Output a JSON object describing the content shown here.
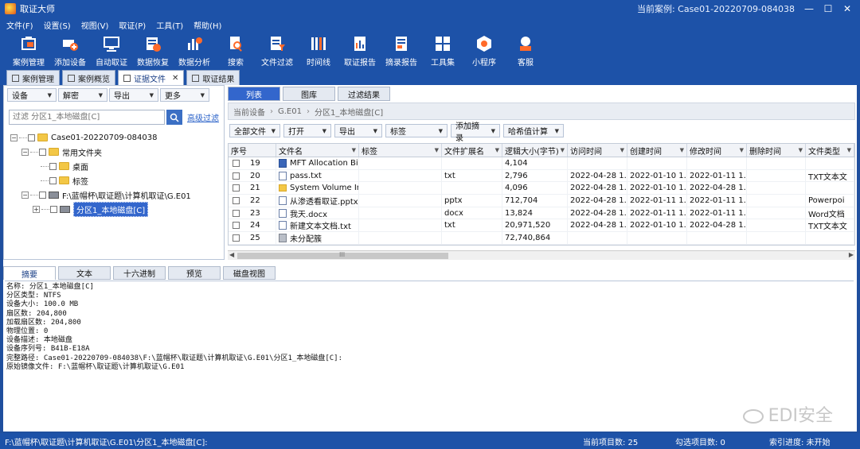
{
  "titlebar": {
    "title": "取证大师",
    "case_label": "当前案例: Case01-20220709-084038",
    "min": "—",
    "max": "☐",
    "close": "✕"
  },
  "menu": [
    "文件(F)",
    "设置(S)",
    "视图(V)",
    "取证(P)",
    "工具(T)",
    "帮助(H)"
  ],
  "toolbar": [
    {
      "label": "案例管理",
      "icon": "case-icon",
      "color": "#ffffff"
    },
    {
      "label": "添加设备",
      "icon": "add-device-icon",
      "color": "#ff6a2a"
    },
    {
      "label": "自动取证",
      "icon": "monitor-icon",
      "color": "#ffffff"
    },
    {
      "label": "数据恢复",
      "icon": "recovery-icon",
      "color": "#ff6a2a"
    },
    {
      "label": "数据分析",
      "icon": "chart-icon",
      "color": "#ff6a2a"
    },
    {
      "label": "搜索",
      "icon": "search-icon",
      "color": "#ffffff"
    },
    {
      "label": "文件过滤",
      "icon": "filter-icon",
      "color": "#ffffff"
    },
    {
      "label": "时间线",
      "icon": "timeline-icon",
      "color": "#ffffff"
    },
    {
      "label": "取证报告",
      "icon": "report-icon",
      "color": "#ffffff"
    },
    {
      "label": "摘录报告",
      "icon": "excerpt-icon",
      "color": "#ffffff"
    },
    {
      "label": "工具集",
      "icon": "tools-icon",
      "color": "#ffffff"
    },
    {
      "label": "小程序",
      "icon": "miniprogram-icon",
      "color": "#ff6a2a"
    },
    {
      "label": "客服",
      "icon": "support-icon",
      "color": "#ff6a2a"
    }
  ],
  "doc_tabs": [
    {
      "label": "案例管理",
      "active": false
    },
    {
      "label": "案例概览",
      "active": false
    },
    {
      "label": "证据文件",
      "active": true,
      "close": "✕"
    },
    {
      "label": "取证结果",
      "active": false
    }
  ],
  "left": {
    "buttons": [
      "设备",
      "解密",
      "导出",
      "更多"
    ],
    "filter_placeholder": "过滤 分区1_本地磁盘[C]",
    "advanced_filter": "高级过滤",
    "tree": {
      "case": "Case01-20220709-084038",
      "common": "常用文件夹",
      "desktop": "桌面",
      "tags": "标签",
      "image": "F:\\蓝帽杯\\取证题\\计算机取证\\G.E01",
      "partition": "分区1_本地磁盘[C]"
    }
  },
  "right": {
    "tabs": [
      "列表",
      "图库",
      "过滤结果"
    ],
    "breadcrumb": [
      "当前设备",
      "G.E01",
      "分区1_本地磁盘[C]"
    ],
    "buttons": [
      "全部文件",
      "打开",
      "导出",
      "标签",
      "添加摘录",
      "哈希值计算"
    ],
    "columns": [
      "序号",
      "文件名",
      "标签",
      "文件扩展名",
      "逻辑大小(字节)",
      "访问时间",
      "创建时间",
      "修改时间",
      "删除时间",
      "文件类型"
    ],
    "rows": [
      {
        "no": "19",
        "name": "MFT Allocation Bit...",
        "icon": "blue",
        "tag": "",
        "ext": "",
        "size": "4,104",
        "access": "",
        "create": "",
        "modify": "",
        "delete": "",
        "type": ""
      },
      {
        "no": "20",
        "name": "pass.txt",
        "icon": "file",
        "tag": "",
        "ext": "txt",
        "size": "2,796",
        "access": "2022-04-28 1...",
        "create": "2022-01-10 1...",
        "modify": "2022-01-11 1...",
        "delete": "",
        "type": "TXT文本文"
      },
      {
        "no": "21",
        "name": "System Volume In...",
        "icon": "folder",
        "tag": "",
        "ext": "",
        "size": "4,096",
        "access": "2022-04-28 1...",
        "create": "2022-01-10 1...",
        "modify": "2022-04-28 1...",
        "delete": "",
        "type": ""
      },
      {
        "no": "22",
        "name": "从渗透看取证.pptx",
        "icon": "file",
        "tag": "",
        "ext": "pptx",
        "size": "712,704",
        "access": "2022-04-28 1...",
        "create": "2022-01-11 1...",
        "modify": "2022-01-11 1...",
        "delete": "",
        "type": "Powerpoi"
      },
      {
        "no": "23",
        "name": "我天.docx",
        "icon": "file",
        "tag": "",
        "ext": "docx",
        "size": "13,824",
        "access": "2022-04-28 1...",
        "create": "2022-01-11 1...",
        "modify": "2022-01-11 1...",
        "delete": "",
        "type": "Word文档"
      },
      {
        "no": "24",
        "name": "新建文本文档.txt",
        "icon": "file",
        "tag": "",
        "ext": "txt",
        "size": "20,971,520",
        "access": "2022-04-28 1...",
        "create": "2022-01-10 1...",
        "modify": "2022-04-28 1...",
        "delete": "",
        "type": "TXT文本文"
      },
      {
        "no": "25",
        "name": "未分配簇",
        "icon": "gray",
        "tag": "",
        "ext": "",
        "size": "72,740,864",
        "access": "",
        "create": "",
        "modify": "",
        "delete": "",
        "type": ""
      }
    ],
    "scroll_thumb": "III"
  },
  "bottom": {
    "tabs": [
      "摘要",
      "文本",
      "十六进制",
      "预览",
      "磁盘视图"
    ],
    "summary": [
      "名称: 分区1_本地磁盘[C]",
      "分区类型: NTFS",
      "设备大小: 100.0 MB",
      "扇区数: 204,800",
      "加载扇区数: 204,800",
      "物理位置: 0",
      "设备描述: 本地磁盘",
      "设备序列号: B41B-E18A",
      "完整路径: Case01-20220709-084038\\F:\\蓝帽杯\\取证题\\计算机取证\\G.E01\\分区1_本地磁盘[C]:",
      "原始镜像文件: F:\\蓝帽杯\\取证题\\计算机取证\\G.E01"
    ]
  },
  "watermark": "EDI安全",
  "statusbar": {
    "path": "F:\\蓝帽杯\\取证题\\计算机取证\\G.E01\\分区1_本地磁盘[C]:",
    "current_items": "当前项目数: 25",
    "checked_items": "勾选项目数: 0",
    "index_progress": "索引进度: 未开始"
  }
}
